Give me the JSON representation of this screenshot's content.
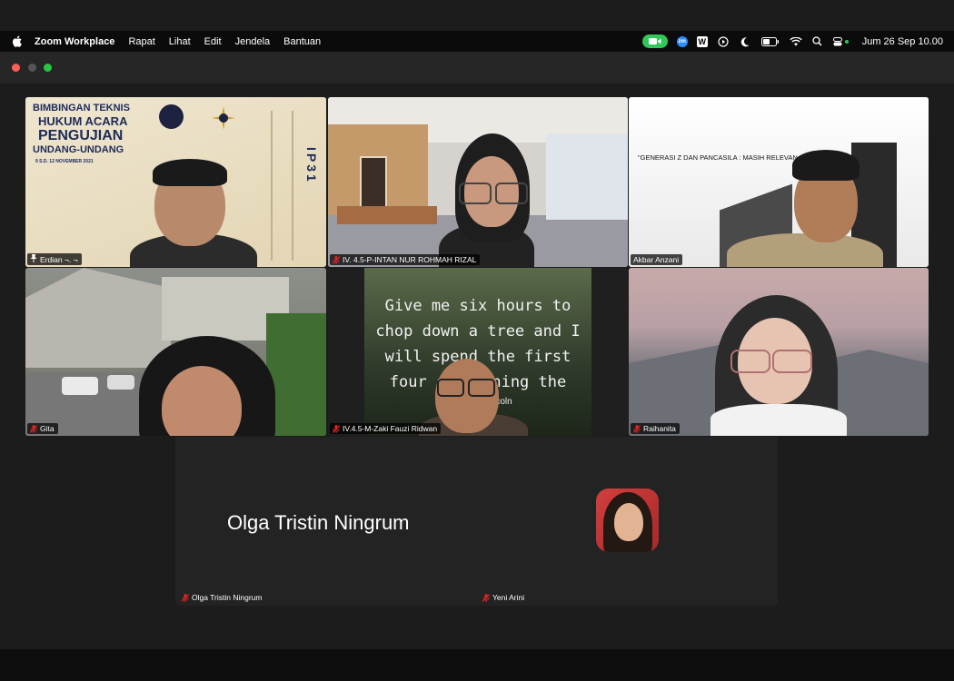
{
  "menubar": {
    "app_name": "Zoom Workplace",
    "items": [
      "Rapat",
      "Lihat",
      "Edit",
      "Jendela",
      "Bantuan"
    ],
    "clock": "Jum 26 Sep  10.00",
    "zm_label": "zm",
    "w_label": "W"
  },
  "slide": {
    "line1": "BIMBINGAN TEKNIS",
    "line2": "HUKUM ACARA",
    "line3": "PENGUJIAN",
    "line4": "UNDANG-UNDANG",
    "date": "9 S.D. 12 NOVEMBER 2021",
    "code": "IP31"
  },
  "tiles": [
    {
      "name": "Erdian ¬. ¬",
      "muted": false,
      "active": true
    },
    {
      "name": "IV. 4.5-P-INTAN NUR ROHMAH RIZAL",
      "muted": true
    },
    {
      "name": "Akbar Anzani",
      "muted": false
    },
    {
      "name": "Gita",
      "muted": true
    },
    {
      "name": "IV.4.5-M-Zaki Fauzi Ridwan",
      "muted": true
    },
    {
      "name": "Raihanita",
      "muted": true
    }
  ],
  "akbar_banner": "\"GENERASI Z DAN PANCASILA : MASIH RELEVAN ?\"",
  "quote": {
    "text": "Give me six hours to chop down a tree and I will spend the first four sharpening the axe.",
    "author": "Lincoln"
  },
  "bottom": {
    "big_name": "Olga Tristin Ningrum",
    "left_tag": "Olga Tristin Ningrum",
    "right_tag": "Yeni Arini"
  },
  "colors": {
    "active_border": "#2ecc40",
    "mute_red": "#e02424",
    "camera_green": "#33c759"
  }
}
